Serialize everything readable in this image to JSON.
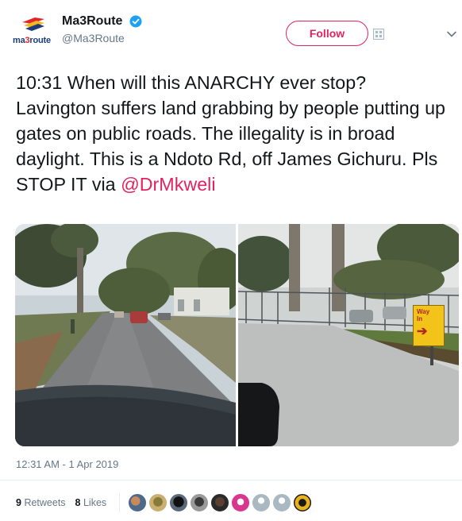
{
  "account": {
    "display_name": "Ma3Route",
    "handle": "@Ma3Route",
    "logo_text_part1": "ma",
    "logo_text_part2": "3",
    "logo_text_part3": "route",
    "verified": true
  },
  "follow_label": "Follow",
  "tweet": {
    "text": "10:31 When will this ANARCHY ever stop? Lavington suffers land grabbing by people putting up gates on public roads. The illegality is in broad daylight. This is a Ndoto Rd, off James Gichuru. Pls STOP IT   via ",
    "mention": "@DrMkweli"
  },
  "photos": {
    "sign_line1": "Way",
    "sign_line2": "In",
    "sign_arrow": "➔"
  },
  "timestamp": "12:31 AM - 1 Apr 2019",
  "stats": {
    "retweets_count": "9",
    "retweets_label": "Retweets",
    "likes_count": "8",
    "likes_label": "Likes"
  },
  "colors": {
    "accent": "#e0245e",
    "verified": "#1da1f2",
    "muted": "#657786"
  },
  "icons": [
    "verified-icon",
    "grid-icon",
    "chevron-down-icon"
  ],
  "likers": [
    "liker-1",
    "liker-2",
    "liker-3",
    "liker-4",
    "liker-5",
    "liker-6",
    "liker-7",
    "liker-8",
    "liker-9"
  ]
}
